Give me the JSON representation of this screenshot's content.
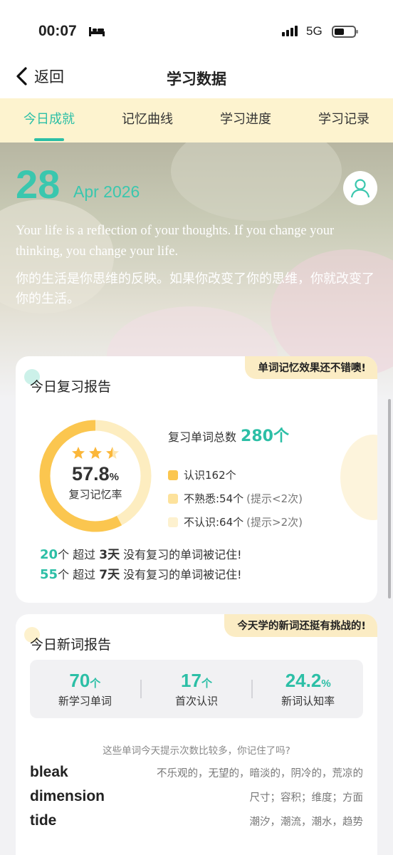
{
  "status_bar": {
    "time": "00:07",
    "network": "5G"
  },
  "header": {
    "back_label": "返回",
    "title": "学习数据"
  },
  "tabs": [
    {
      "label": "今日成就",
      "active": true
    },
    {
      "label": "记忆曲线",
      "active": false
    },
    {
      "label": "学习进度",
      "active": false
    },
    {
      "label": "学习记录",
      "active": false
    }
  ],
  "hero": {
    "day": "28",
    "month_year": "Apr 2026",
    "quote_en": "Your life is a reflection of your thoughts. If you change your thinking, you change your life.",
    "quote_cn": "你的生活是你思维的反映。如果你改变了你的思维，你就改变了你的生活。"
  },
  "review_report": {
    "badge": "单词记忆效果还不错噢!",
    "title": "今日复习报告",
    "stars": 2.5,
    "rate": "57.8",
    "rate_unit": "%",
    "rate_label": "复习记忆率",
    "total_label": "复习单词总数",
    "total_value": "280个",
    "legend": [
      {
        "label": "认识162个",
        "hint": "",
        "color": "#fbc64f"
      },
      {
        "label": "不熟悉:54个",
        "hint": "(提示<2次)",
        "color": "#fde29c"
      },
      {
        "label": "不认识:64个",
        "hint": "(提示>2次)",
        "color": "#fdf1cf"
      }
    ],
    "beyond": [
      {
        "count": "20",
        "pre": "个 超过 ",
        "days": "3天",
        "post": " 没有复习的单词被记住!"
      },
      {
        "count": "55",
        "pre": "个 超过 ",
        "days": "7天",
        "post": " 没有复习的单词被记住!"
      }
    ]
  },
  "new_report": {
    "badge": "今天学的新词还挺有挑战的!",
    "title": "今日新词报告",
    "stats": [
      {
        "value": "70",
        "unit": "个",
        "label": "新学习单词"
      },
      {
        "value": "17",
        "unit": "个",
        "label": "首次认识"
      },
      {
        "value": "24.2",
        "unit": "%",
        "label": "新词认知率"
      }
    ],
    "question": "这些单词今天提示次数比较多，你记住了吗?",
    "words": [
      {
        "word": "bleak",
        "meaning": "不乐观的，无望的，暗淡的，阴冷的，荒凉的"
      },
      {
        "word": "dimension",
        "meaning": "尺寸；容积；维度；方面"
      },
      {
        "word": "tide",
        "meaning": "潮汐，潮流，潮水，趋势"
      }
    ]
  },
  "colors": {
    "accent": "#2cbfa6",
    "ring_main": "#fbc64f",
    "ring_track": "#fdedc0",
    "tab_bg": "#fdf3cf"
  }
}
